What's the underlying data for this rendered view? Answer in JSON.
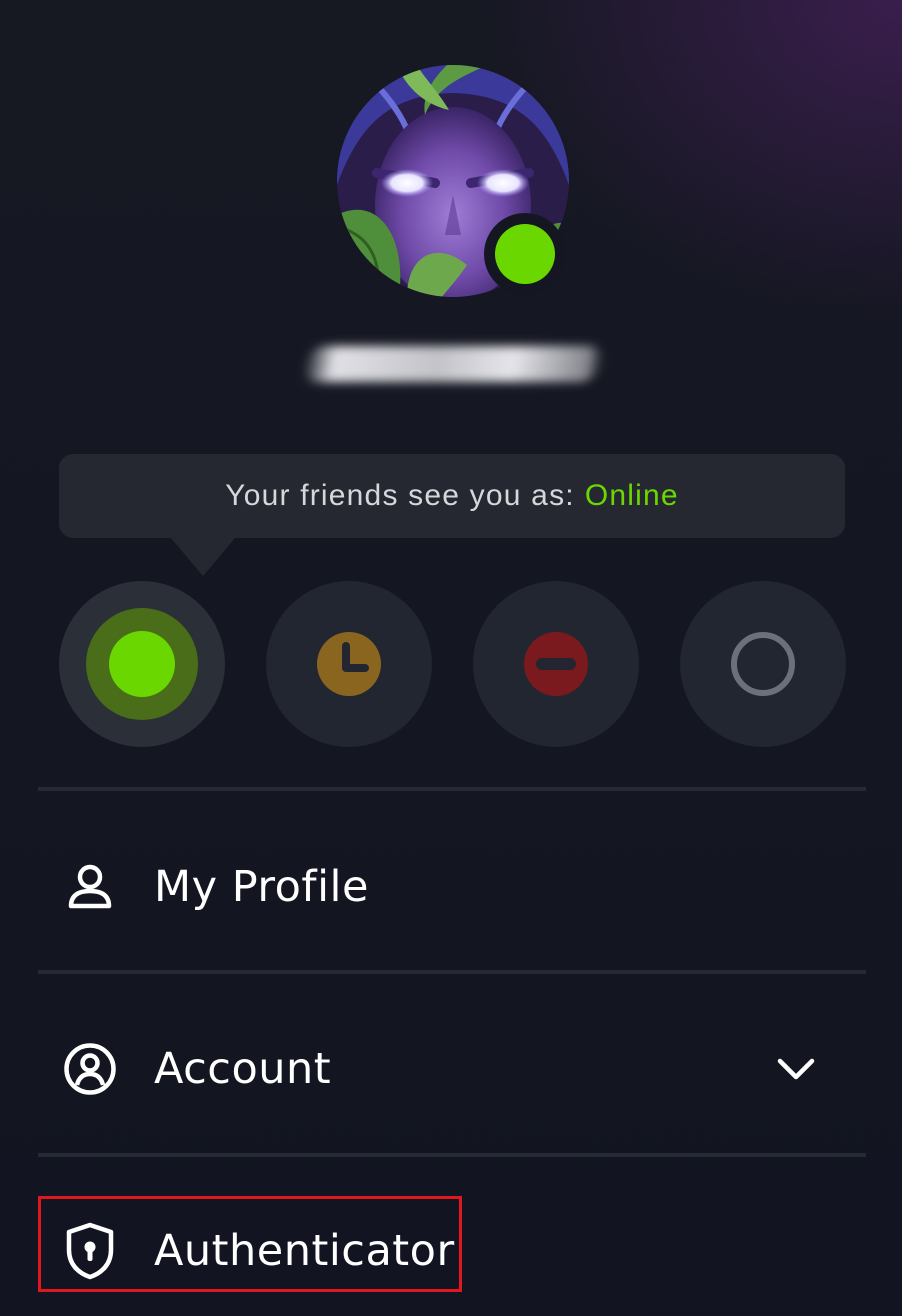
{
  "profile": {
    "avatar_icon": "avatar-elf-character",
    "presence_status": "online",
    "name_redacted": true
  },
  "status": {
    "prefix": "Your friends see you as:",
    "current": "Online",
    "options": [
      {
        "id": "online",
        "icon": "online-dot-icon",
        "color": "#6ad800",
        "selected": true
      },
      {
        "id": "away",
        "icon": "clock-icon",
        "color": "#8a6520",
        "selected": false
      },
      {
        "id": "busy",
        "icon": "minus-circle-icon",
        "color": "#7a1a1f",
        "selected": false
      },
      {
        "id": "offline",
        "icon": "empty-circle-icon",
        "color": "#6d7079",
        "selected": false
      }
    ]
  },
  "menu": {
    "my_profile": {
      "label": "My Profile",
      "icon": "person-icon"
    },
    "account": {
      "label": "Account",
      "icon": "user-circle-icon",
      "expand_icon": "chevron-down-icon"
    },
    "authenticator": {
      "label": "Authenticator",
      "icon": "shield-lock-icon",
      "highlighted": true
    }
  },
  "colors": {
    "background": "#14161f",
    "accent_online": "#6ad800",
    "highlight_border": "#e2161f"
  }
}
